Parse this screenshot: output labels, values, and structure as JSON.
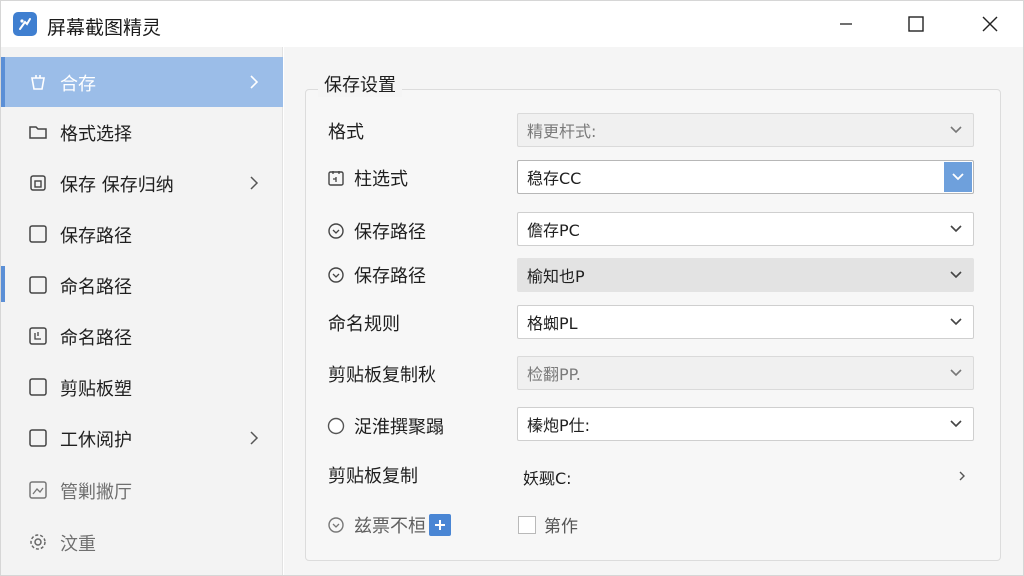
{
  "app": {
    "title": "屏幕截图精灵",
    "accent_color": "#5b8fd6"
  },
  "window_controls": {
    "minimize_icon": "minimize-icon",
    "maximize_icon": "maximize-icon",
    "close_icon": "close-icon"
  },
  "sidebar": {
    "items": [
      {
        "label": "合存",
        "icon": "basket-icon",
        "active": true,
        "chevron": true
      },
      {
        "label": "格式选择",
        "icon": "folder-icon",
        "chevron": false
      },
      {
        "label": "保存 保存归纳",
        "icon": "save-icon",
        "chevron": true
      },
      {
        "label": "保存路径",
        "icon": "square-icon",
        "chevron": false
      },
      {
        "label": "命名路径",
        "icon": "square-icon",
        "chevron": false
      },
      {
        "label": "命名路径",
        "icon": "crop-icon",
        "chevron": false
      },
      {
        "label": "剪贴板塑",
        "icon": "square-icon",
        "chevron": false
      },
      {
        "label": "工休阅护",
        "icon": "square-icon",
        "chevron": true
      },
      {
        "label": "管剿撇厅",
        "icon": "image-icon",
        "chevron": false
      },
      {
        "label": "汶重",
        "icon": "gear-icon",
        "chevron": false
      }
    ]
  },
  "group": {
    "title": "保存设置"
  },
  "rows": [
    {
      "label": "格式",
      "value": "精更杆式:",
      "state": "disabled"
    },
    {
      "label": "柱选式",
      "value": "稳存CC",
      "state": "focused",
      "icon": "calendar-icon"
    },
    {
      "label": "保存路径",
      "value": "儋存PC",
      "state": "normal",
      "icon": "clock-icon"
    },
    {
      "label": "保存路径",
      "value": "榆知也P",
      "state": "flat",
      "icon": "clock-icon"
    },
    {
      "label": "命名规则",
      "value": "格蜘PL",
      "state": "normal"
    },
    {
      "label": "剪贴板复制秋",
      "value": "检翻PP.",
      "state": "disabled"
    },
    {
      "label": "浞淮撰聚蹋",
      "value": "榛炮P仕:",
      "state": "normal",
      "icon": "radio-icon"
    },
    {
      "label": "剪贴板复制",
      "value": "妖觋C:",
      "state": "plain"
    }
  ],
  "footer_row": {
    "label": "兹票不桓",
    "plus_label": "+",
    "checkbox_label": "第作"
  }
}
